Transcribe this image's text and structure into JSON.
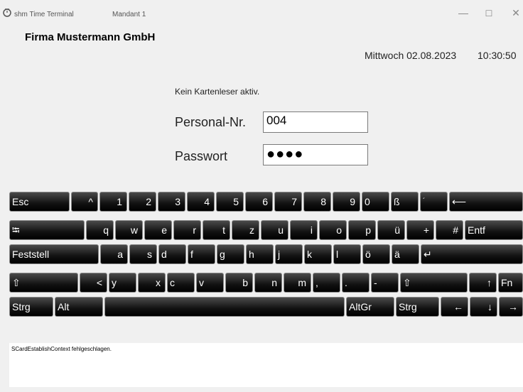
{
  "window": {
    "title": "shm Time Terminal",
    "mandant": "Mandant 1",
    "minimize_glyph": "—",
    "maximize_glyph": "☐",
    "close_glyph": "✕"
  },
  "header": {
    "company": "Firma Mustermann GmbH",
    "date": "Mittwoch 02.08.2023",
    "time": "10:30:50"
  },
  "login": {
    "status": "Kein Kartenleser aktiv.",
    "personal_label": "Personal-Nr.",
    "personal_value": "004",
    "password_label": "Passwort",
    "password_masked": "●●●●"
  },
  "keyboard": {
    "rows": [
      [
        "Esc",
        "^",
        "1",
        "2",
        "3",
        "4",
        "5",
        "6",
        "7",
        "8",
        "9",
        "0",
        "ß",
        "´",
        "⟵"
      ],
      [
        "⭾",
        "q",
        "w",
        "e",
        "r",
        "t",
        "z",
        "u",
        "i",
        "o",
        "p",
        "ü",
        "+",
        "#",
        "Entf"
      ],
      [
        "Feststell",
        "a",
        "s",
        "d",
        "f",
        "g",
        "h",
        "j",
        "k",
        "l",
        "ö",
        "ä",
        "↵"
      ],
      [
        "⇧",
        "<",
        "y",
        "x",
        "c",
        "v",
        "b",
        "n",
        "m",
        ",",
        ".",
        "-",
        "⇧",
        "↑",
        "Fn"
      ],
      [
        "Strg",
        "Alt",
        "",
        "AltGr",
        "Strg",
        "←",
        "↓",
        "→"
      ]
    ]
  },
  "message": {
    "text": "SCardEstablishContext fehlgeschlagen."
  }
}
